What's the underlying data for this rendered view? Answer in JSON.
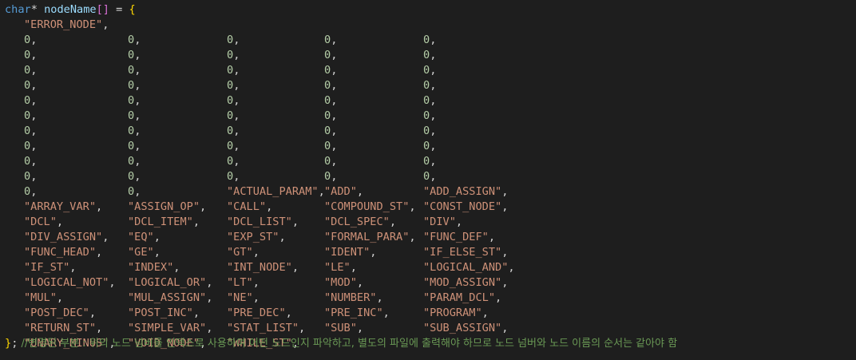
{
  "header": {
    "type_keyword": "char",
    "star": "*",
    "var_name": "nodeName",
    "brackets": "[]",
    "assign": " = ",
    "open_brace": "{"
  },
  "rows": [
    [
      {
        "t": "str",
        "v": "\"ERROR_NODE\""
      }
    ],
    [
      {
        "t": "num",
        "v": "0"
      },
      {
        "t": "num",
        "v": "0"
      },
      {
        "t": "num",
        "v": "0"
      },
      {
        "t": "num",
        "v": "0"
      },
      {
        "t": "num",
        "v": "0"
      }
    ],
    [
      {
        "t": "num",
        "v": "0"
      },
      {
        "t": "num",
        "v": "0"
      },
      {
        "t": "num",
        "v": "0"
      },
      {
        "t": "num",
        "v": "0"
      },
      {
        "t": "num",
        "v": "0"
      }
    ],
    [
      {
        "t": "num",
        "v": "0"
      },
      {
        "t": "num",
        "v": "0"
      },
      {
        "t": "num",
        "v": "0"
      },
      {
        "t": "num",
        "v": "0"
      },
      {
        "t": "num",
        "v": "0"
      }
    ],
    [
      {
        "t": "num",
        "v": "0"
      },
      {
        "t": "num",
        "v": "0"
      },
      {
        "t": "num",
        "v": "0"
      },
      {
        "t": "num",
        "v": "0"
      },
      {
        "t": "num",
        "v": "0"
      }
    ],
    [
      {
        "t": "num",
        "v": "0"
      },
      {
        "t": "num",
        "v": "0"
      },
      {
        "t": "num",
        "v": "0"
      },
      {
        "t": "num",
        "v": "0"
      },
      {
        "t": "num",
        "v": "0"
      }
    ],
    [
      {
        "t": "num",
        "v": "0"
      },
      {
        "t": "num",
        "v": "0"
      },
      {
        "t": "num",
        "v": "0"
      },
      {
        "t": "num",
        "v": "0"
      },
      {
        "t": "num",
        "v": "0"
      }
    ],
    [
      {
        "t": "num",
        "v": "0"
      },
      {
        "t": "num",
        "v": "0"
      },
      {
        "t": "num",
        "v": "0"
      },
      {
        "t": "num",
        "v": "0"
      },
      {
        "t": "num",
        "v": "0"
      }
    ],
    [
      {
        "t": "num",
        "v": "0"
      },
      {
        "t": "num",
        "v": "0"
      },
      {
        "t": "num",
        "v": "0"
      },
      {
        "t": "num",
        "v": "0"
      },
      {
        "t": "num",
        "v": "0"
      }
    ],
    [
      {
        "t": "num",
        "v": "0"
      },
      {
        "t": "num",
        "v": "0"
      },
      {
        "t": "num",
        "v": "0"
      },
      {
        "t": "num",
        "v": "0"
      },
      {
        "t": "num",
        "v": "0"
      }
    ],
    [
      {
        "t": "num",
        "v": "0"
      },
      {
        "t": "num",
        "v": "0"
      },
      {
        "t": "num",
        "v": "0"
      },
      {
        "t": "num",
        "v": "0"
      },
      {
        "t": "num",
        "v": "0"
      }
    ],
    [
      {
        "t": "num",
        "v": "0"
      },
      {
        "t": "num",
        "v": "0"
      },
      {
        "t": "str",
        "v": "\"ACTUAL_PARAM\""
      },
      {
        "t": "str",
        "v": "\"ADD\""
      },
      {
        "t": "str",
        "v": "\"ADD_ASSIGN\""
      }
    ],
    [
      {
        "t": "str",
        "v": "\"ARRAY_VAR\""
      },
      {
        "t": "str",
        "v": "\"ASSIGN_OP\""
      },
      {
        "t": "str",
        "v": "\"CALL\""
      },
      {
        "t": "str",
        "v": "\"COMPOUND_ST\""
      },
      {
        "t": "str",
        "v": "\"CONST_NODE\""
      }
    ],
    [
      {
        "t": "str",
        "v": "\"DCL\""
      },
      {
        "t": "str",
        "v": "\"DCL_ITEM\""
      },
      {
        "t": "str",
        "v": "\"DCL_LIST\""
      },
      {
        "t": "str",
        "v": "\"DCL_SPEC\""
      },
      {
        "t": "str",
        "v": "\"DIV\""
      }
    ],
    [
      {
        "t": "str",
        "v": "\"DIV_ASSIGN\""
      },
      {
        "t": "str",
        "v": "\"EQ\""
      },
      {
        "t": "str",
        "v": "\"EXP_ST\""
      },
      {
        "t": "str",
        "v": "\"FORMAL_PARA\""
      },
      {
        "t": "str",
        "v": "\"FUNC_DEF\""
      }
    ],
    [
      {
        "t": "str",
        "v": "\"FUNC_HEAD\""
      },
      {
        "t": "str",
        "v": "\"GE\""
      },
      {
        "t": "str",
        "v": "\"GT\""
      },
      {
        "t": "str",
        "v": "\"IDENT\""
      },
      {
        "t": "str",
        "v": "\"IF_ELSE_ST\""
      }
    ],
    [
      {
        "t": "str",
        "v": "\"IF_ST\""
      },
      {
        "t": "str",
        "v": "\"INDEX\""
      },
      {
        "t": "str",
        "v": "\"INT_NODE\""
      },
      {
        "t": "str",
        "v": "\"LE\""
      },
      {
        "t": "str",
        "v": "\"LOGICAL_AND\""
      }
    ],
    [
      {
        "t": "str",
        "v": "\"LOGICAL_NOT\""
      },
      {
        "t": "str",
        "v": "\"LOGICAL_OR\""
      },
      {
        "t": "str",
        "v": "\"LT\""
      },
      {
        "t": "str",
        "v": "\"MOD\""
      },
      {
        "t": "str",
        "v": "\"MOD_ASSIGN\""
      }
    ],
    [
      {
        "t": "str",
        "v": "\"MUL\""
      },
      {
        "t": "str",
        "v": "\"MUL_ASSIGN\""
      },
      {
        "t": "str",
        "v": "\"NE\""
      },
      {
        "t": "str",
        "v": "\"NUMBER\""
      },
      {
        "t": "str",
        "v": "\"PARAM_DCL\""
      }
    ],
    [
      {
        "t": "str",
        "v": "\"POST_DEC\""
      },
      {
        "t": "str",
        "v": "\"POST_INC\""
      },
      {
        "t": "str",
        "v": "\"PRE_DEC\""
      },
      {
        "t": "str",
        "v": "\"PRE_INC\""
      },
      {
        "t": "str",
        "v": "\"PROGRAM\""
      }
    ],
    [
      {
        "t": "str",
        "v": "\"RETURN_ST\""
      },
      {
        "t": "str",
        "v": "\"SIMPLE_VAR\""
      },
      {
        "t": "str",
        "v": "\"STAT_LIST\""
      },
      {
        "t": "str",
        "v": "\"SUB\""
      },
      {
        "t": "str",
        "v": "\"SUB_ASSIGN\""
      }
    ],
    [
      {
        "t": "str",
        "v": "\"UNARY_MINUS\""
      },
      {
        "t": "str",
        "v": "\"VOID_NODE\""
      },
      {
        "t": "str",
        "v": "\"WHILE_ST\""
      }
    ]
  ],
  "footer": {
    "close_brace": "}",
    "semicolon": ";",
    "comment": " //변경된 부분 : 위의 노드 넘버를 인덱스로 사용하여 어떤 노드인지 파악하고, 별도의 파일에 출력해야 하므로 노드 넘버와 노드 이름의 순서는 같아야 함"
  },
  "colors": {
    "background": "#1e1e1e",
    "keyword": "#569cd6",
    "identifier": "#9cdcfe",
    "string": "#ce9178",
    "number": "#b5cea8",
    "comment": "#6a9955",
    "brace": "#ffd700",
    "bracket": "#da70d6"
  }
}
